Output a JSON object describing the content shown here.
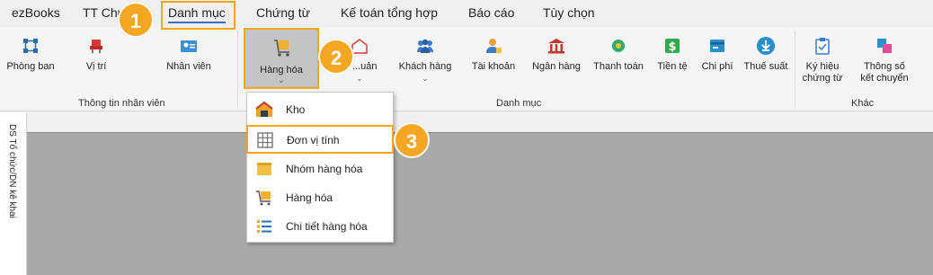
{
  "tabs": [
    "ezBooks",
    "TT Chu",
    "Danh mục",
    "Chứng từ",
    "Kế toán tổng hợp",
    "Báo cáo",
    "Tùy chọn"
  ],
  "ribbon": {
    "group1": {
      "items": [
        "Phòng ban",
        "Vị trí",
        "Nhân viên"
      ],
      "label": "Thông tin nhân viên"
    },
    "group2": {
      "items": [
        "Hàng hóa",
        "...uản",
        "Khách hàng",
        "Tài khoản",
        "Ngân hàng",
        "Thanh toán",
        "Tiền tệ",
        "Chi phí",
        "Thuế suất"
      ],
      "label": "Danh mục"
    },
    "group3": {
      "items": [
        "Ký hiệu",
        "chứng từ",
        "Thông số",
        "kết chuyển"
      ],
      "label": "Khác"
    }
  },
  "left_pane": {
    "label": "DS Tổ chức/DN kê khai"
  },
  "dropdown": {
    "items": [
      "Kho",
      "Đơn vị tính",
      "Nhóm hàng hóa",
      "Hàng hóa",
      "Chi tiết hàng hóa"
    ]
  },
  "badges": [
    "1",
    "2",
    "3"
  ],
  "colors": {
    "accent": "#f5a623",
    "tab_underline": "#3b6fc4",
    "main_bg": "#a9a9a9"
  }
}
